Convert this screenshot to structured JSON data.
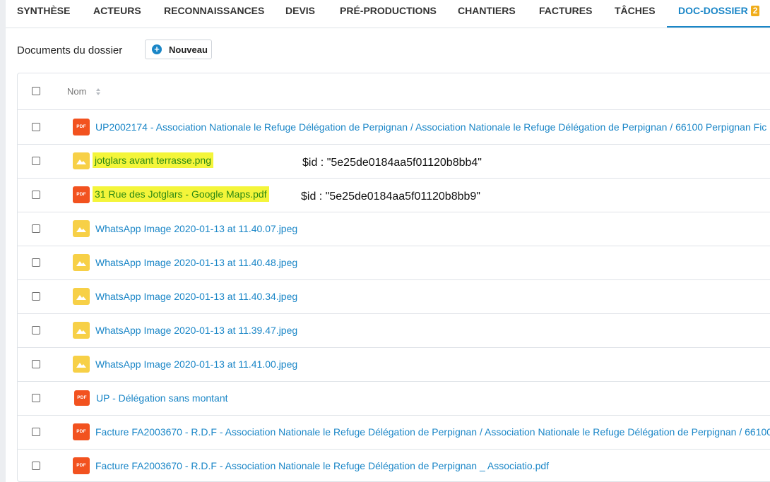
{
  "tabs": [
    {
      "label": "SYNTHÈSE"
    },
    {
      "label": "ACTEURS"
    },
    {
      "label": "RECONNAISSANCES"
    },
    {
      "label": "DEVIS"
    },
    {
      "label": "PRÉ-PRODUCTIONS"
    },
    {
      "label": "CHANTIERS"
    },
    {
      "label": "FACTURES"
    },
    {
      "label": "TÂCHES"
    },
    {
      "label": "DOC-DOSSIER",
      "badge": "2"
    }
  ],
  "section": {
    "title": "Documents du dossier",
    "new_button": "Nouveau"
  },
  "table": {
    "column_name": "Nom"
  },
  "files": [
    {
      "type": "pdf",
      "icon_text": "PDF",
      "name": "UP2002174 - Association Nationale le Refuge Délégation de Perpignan / Association Nationale le Refuge Délégation de Perpignan / 66100 Perpignan Fic"
    },
    {
      "type": "img",
      "name": "jotglars avant terrasse.png"
    },
    {
      "type": "pdf",
      "icon_text": "PDF",
      "name": "31 Rue des Jotglars - Google Maps.pdf"
    },
    {
      "type": "img",
      "name": "WhatsApp Image 2020-01-13 at 11.40.07.jpeg"
    },
    {
      "type": "img",
      "name": "WhatsApp Image 2020-01-13 at 11.40.48.jpeg"
    },
    {
      "type": "img",
      "name": "WhatsApp Image 2020-01-13 at 11.40.34.jpeg"
    },
    {
      "type": "img",
      "name": "WhatsApp Image 2020-01-13 at 11.39.47.jpeg"
    },
    {
      "type": "img",
      "name": "WhatsApp Image 2020-01-13 at 11.41.00.jpeg"
    },
    {
      "type": "pdf",
      "icon_text": "PDF",
      "name": "UP - Délégation sans montant"
    },
    {
      "type": "pdf",
      "icon_text": "PDF",
      "name": "Facture FA2003670 - R.D.F - Association Nationale le Refuge Délégation de Perpignan / Association Nationale le Refuge Délégation de Perpignan / 66100"
    },
    {
      "type": "pdf",
      "icon_text": "PDF",
      "name": "Facture FA2003670 - R.D.F - Association Nationale le Refuge Délégation de Perpignan _ Associatio.pdf"
    }
  ],
  "annotations": [
    {
      "text": "$id : \"5e25de0184aa5f01120b8bb4\""
    },
    {
      "text": "$id : \"5e25de0184aa5f01120b8bb9\""
    }
  ],
  "colors": {
    "accent": "#1a86c7",
    "badge": "#f0ad1b",
    "pdf": "#f2521f",
    "image": "#f7d047",
    "highlight": "#f4f53a"
  }
}
